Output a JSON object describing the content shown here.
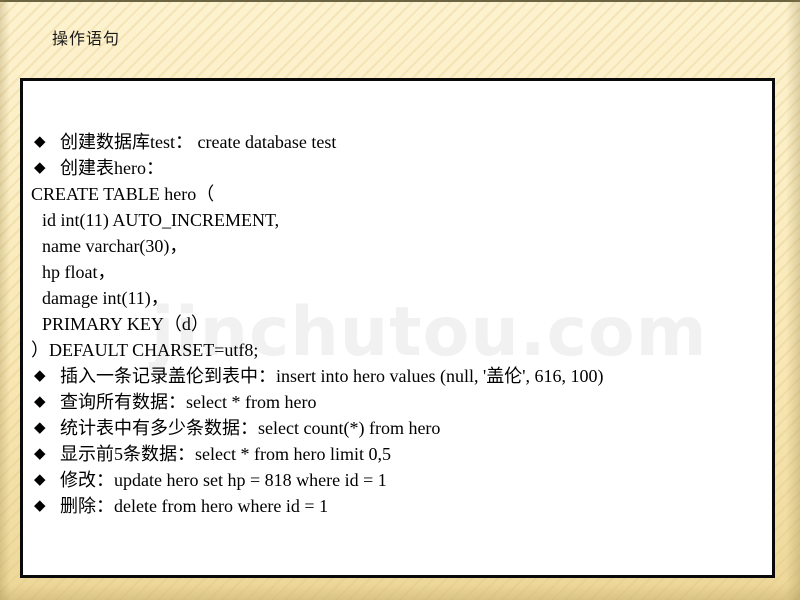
{
  "slide": {
    "title": "操作语句",
    "watermark": "jinchutou.com",
    "accent_background": "#f8e7b4",
    "frame_border_color": "#0a0a0a",
    "frame_fill_color": "#ffffff",
    "top_rule_color": "#6b6342",
    "watermark_color": "#f1f1f1",
    "bullet_glyph": "◆"
  },
  "content": {
    "lines": [
      {
        "id": "create-database",
        "style": "bullet",
        "text": "创建数据库test：  create database test"
      },
      {
        "id": "create-table-head",
        "style": "bullet",
        "text": "创建表hero："
      },
      {
        "id": "ddl-create",
        "style": "plain",
        "text": "CREATE TABLE hero（"
      },
      {
        "id": "ddl-id",
        "style": "indent",
        "text": "id int(11) AUTO_INCREMENT,"
      },
      {
        "id": "ddl-name",
        "style": "indent",
        "text": "name varchar(30)，"
      },
      {
        "id": "ddl-hp",
        "style": "indent",
        "text": "hp float，"
      },
      {
        "id": "ddl-damage",
        "style": "indent",
        "text": "damage int(11)，"
      },
      {
        "id": "ddl-primary-key",
        "style": "indent",
        "text": "PRIMARY KEY（d）"
      },
      {
        "id": "ddl-charset",
        "style": "plain",
        "text": "）DEFAULT CHARSET=utf8;"
      },
      {
        "id": "insert-row",
        "style": "bullet",
        "text": "插入一条记录盖伦到表中：insert into hero values (null, '盖伦', 616, 100)"
      },
      {
        "id": "select-all",
        "style": "bullet",
        "text": "查询所有数据：select * from hero"
      },
      {
        "id": "count-rows",
        "style": "bullet",
        "text": "统计表中有多少条数据：select count(*) from hero"
      },
      {
        "id": "limit-five",
        "style": "bullet",
        "text": "显示前5条数据：select * from hero limit 0,5"
      },
      {
        "id": "update-row",
        "style": "bullet",
        "text": "修改：update hero set hp = 818 where id = 1"
      },
      {
        "id": "delete-row",
        "style": "bullet",
        "text": "删除：delete from hero where id = 1"
      }
    ]
  }
}
